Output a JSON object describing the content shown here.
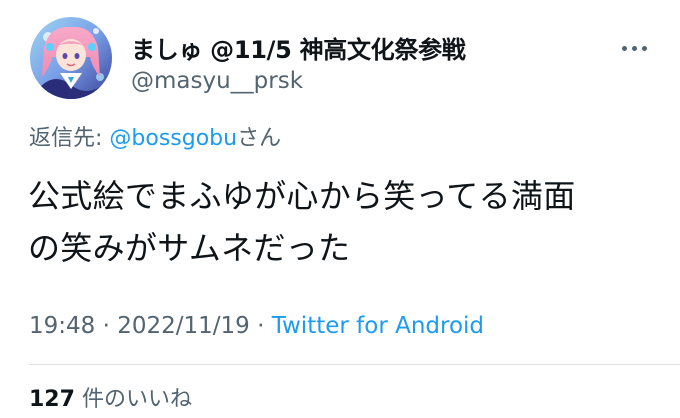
{
  "user": {
    "display_name": "ましゅ @11/5 神高文化祭参戦",
    "handle": "@masyu__prsk",
    "avatar_icon": "anime-girl-avatar"
  },
  "more_icon": "more-horizontal-icon",
  "reply": {
    "prefix": "返信先: ",
    "mention": "@bossgobu",
    "suffix": "さん"
  },
  "tweet": {
    "lines": [
      "公式絵でまふゆが心から笑ってる満面",
      "の笑みがサムネだった"
    ]
  },
  "meta": {
    "time": "19:48",
    "separator1": " · ",
    "date": "2022/11/19",
    "separator2": " · ",
    "source": "Twitter for Android"
  },
  "stats": {
    "likes_count": "127",
    "likes_label": "件のいいね"
  },
  "colors": {
    "link": "#1d9bf0",
    "secondary_text": "#536471",
    "primary_text": "#0f1419"
  }
}
